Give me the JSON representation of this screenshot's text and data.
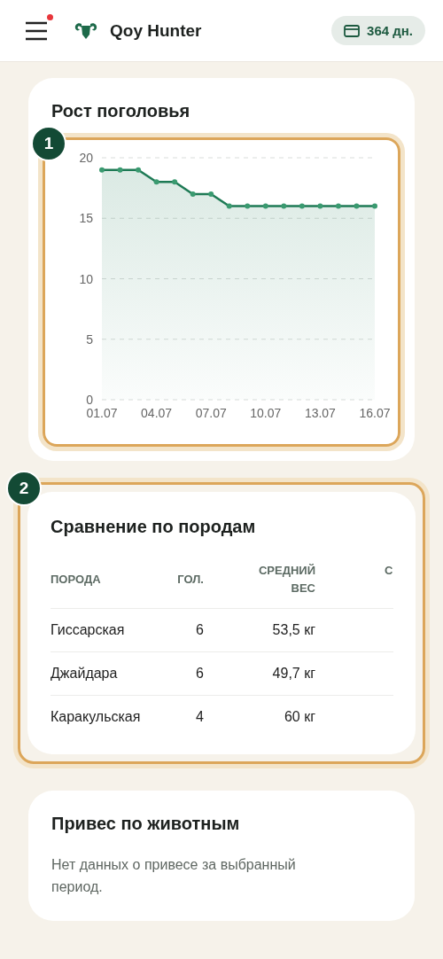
{
  "header": {
    "menu_notification": true,
    "app_name": "Qoy Hunter",
    "days_badge": "364 дн."
  },
  "growth_card": {
    "title": "Рост поголовья",
    "highlight": {
      "number": "1"
    },
    "chart_data": {
      "type": "line",
      "categories": [
        "01.07",
        null,
        null,
        "04.07",
        null,
        null,
        "07.07",
        null,
        null,
        "10.07",
        null,
        null,
        "13.07",
        null,
        null,
        "16.07"
      ],
      "grid": true,
      "series": [
        {
          "color": "#1e7a55",
          "marker": true,
          "values": [
            19,
            19,
            19,
            18,
            18,
            17,
            17,
            16,
            16,
            16,
            16,
            16,
            16,
            16,
            16,
            16
          ]
        }
      ],
      "ylim": [
        0,
        20
      ],
      "yticks": [
        0,
        5,
        10,
        15,
        20
      ]
    }
  },
  "breeds_card": {
    "title": "Сравнение по породам",
    "highlight": {
      "number": "2"
    },
    "columns": [
      "ПОРОДА",
      "ГОЛ.",
      "СРЕДНИЙ ВЕС",
      "С"
    ],
    "rows": [
      [
        "Гиссарская",
        "6",
        "53,5 кг"
      ],
      [
        "Джайдара",
        "6",
        "49,7 кг"
      ],
      [
        "Каракульская",
        "4",
        "60 кг"
      ]
    ]
  },
  "weight_card": {
    "title": "Привес по животным",
    "message": "Нет данных о привесе за выбранный период."
  }
}
